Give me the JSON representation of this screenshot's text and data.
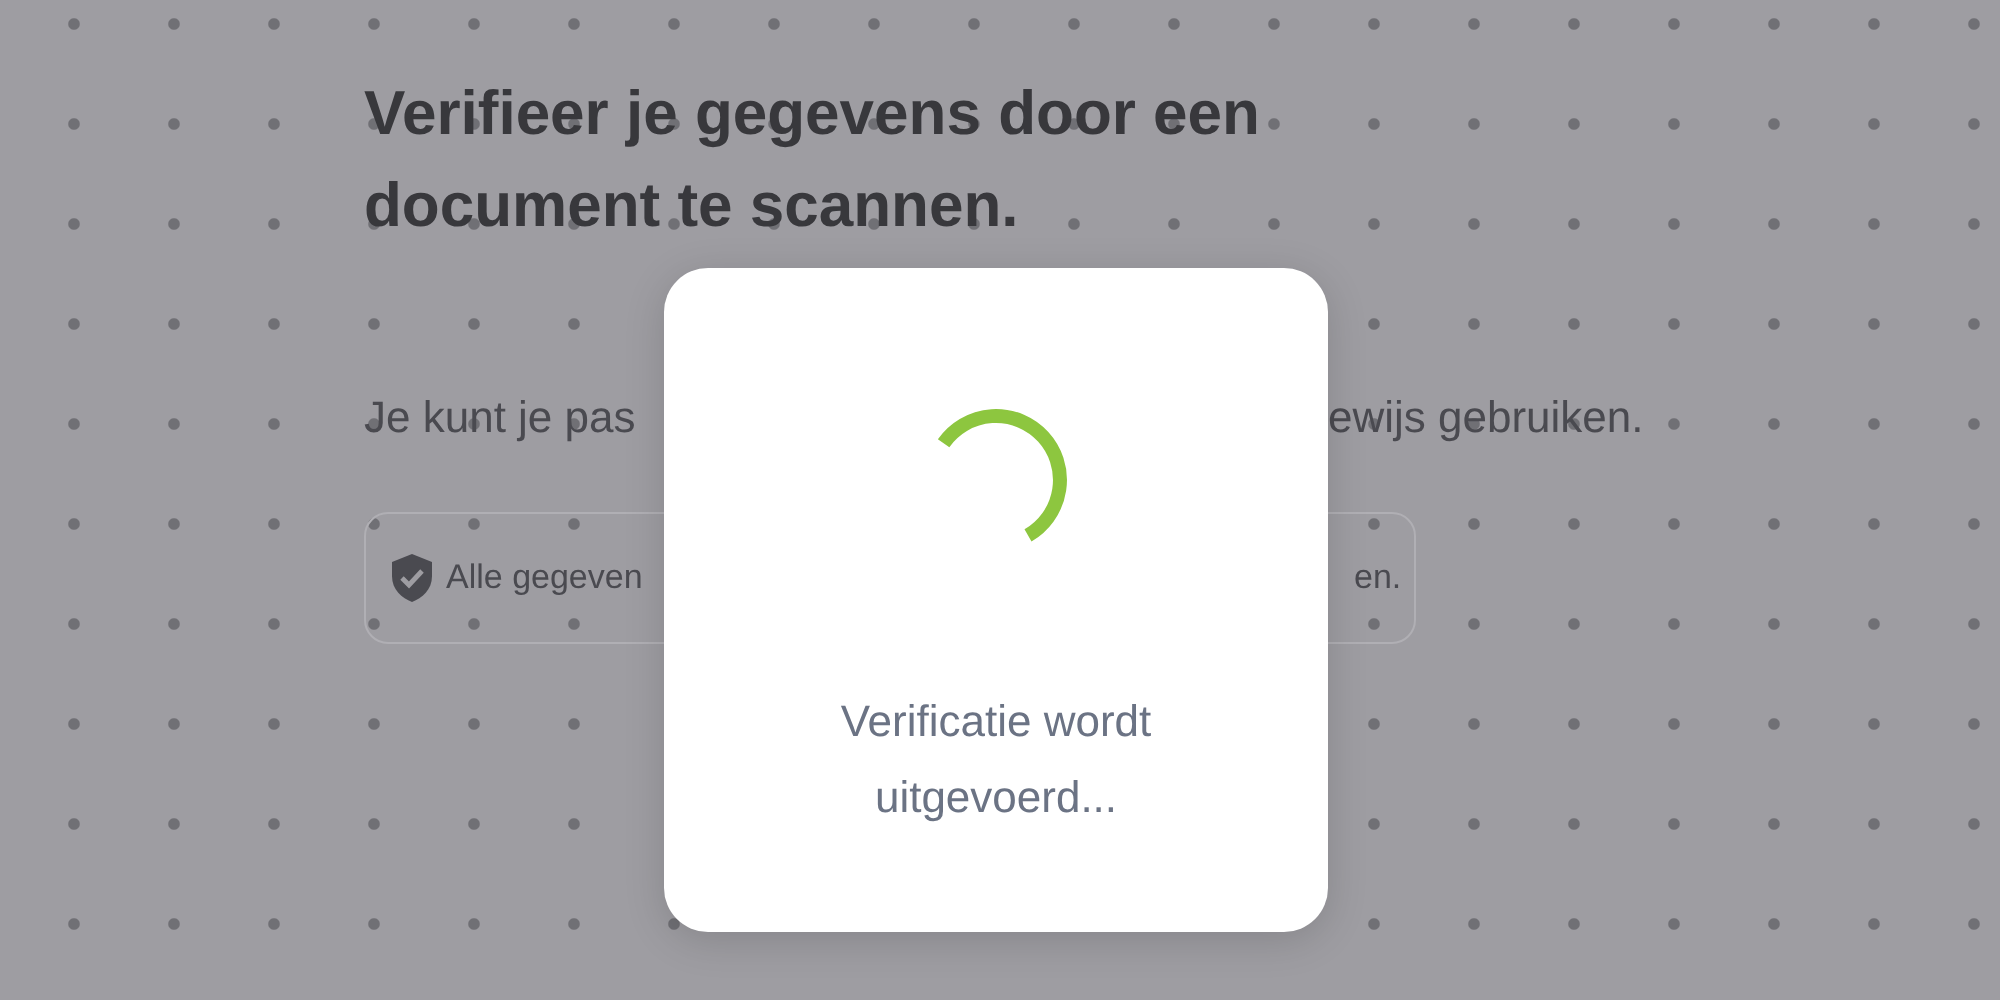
{
  "heading": "Verifieer je gegevens door een document te scannen.",
  "intro": {
    "visible_start": "Je kunt je pas",
    "visible_end": "ewijs gebruiken."
  },
  "notice": {
    "visible_start": "Alle gegeven",
    "visible_end": "en."
  },
  "dialog": {
    "message": "Verificatie wordt uitgevoerd..."
  }
}
